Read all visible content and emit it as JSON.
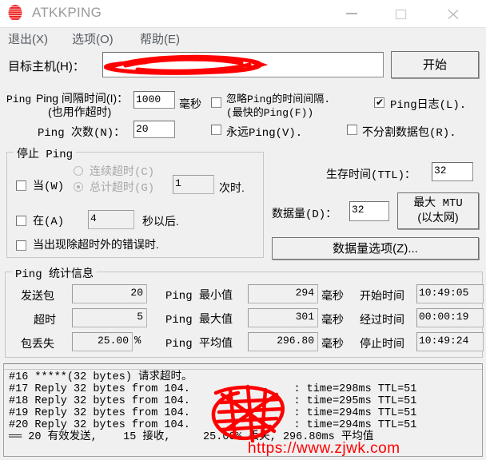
{
  "window": {
    "title": "ATKKPING",
    "icon": "striped-globe-icon",
    "controls": {
      "minimize": "minimize-icon",
      "maximize": "maximize-icon",
      "close": "close-icon"
    }
  },
  "menu": {
    "items": [
      {
        "label": "退出(X)"
      },
      {
        "label": "选项(O)"
      },
      {
        "label": "帮助(E)"
      }
    ]
  },
  "target": {
    "label": "目标主机(H)：",
    "value": "",
    "redacted": true,
    "start_button": "开始"
  },
  "ping_options": {
    "interval_label_line1": "Ping 间隔时间(I)：",
    "interval_label_line2": "(也用作超时)",
    "interval_value": "1000",
    "interval_unit": "毫秒",
    "ignore_interval_label_line1": "忽略Ping的时间间隔.",
    "ignore_interval_label_line2": "(最快的Ping(F))",
    "ignore_interval_checked": false,
    "ping_log_label": "Ping日志(L).",
    "ping_log_checked": true,
    "count_label": "Ping 次数(N)：",
    "count_value": "20",
    "forever_label": "永远Ping(V).",
    "forever_checked": false,
    "nofrag_label": "不分割数据包(R).",
    "nofrag_checked": false
  },
  "stop_ping": {
    "group_title": "停止 Ping",
    "when_label": "当(W)",
    "when_checked": false,
    "radio_consecutive": "连续超时(C)",
    "radio_consecutive_selected": false,
    "radio_total": "总计超时(G)",
    "radio_total_selected": true,
    "times_value": "1",
    "times_suffix": "次时.",
    "after_label": "在(A)",
    "after_checked": false,
    "after_value": "4",
    "after_suffix": "秒以后.",
    "on_error_label": "当出现除超时外的错误时.",
    "on_error_checked": false
  },
  "packet": {
    "ttl_label": "生存时间(TTL)：",
    "ttl_value": "32",
    "size_label": "数据量(D)：",
    "size_value": "32",
    "mtu_button_line1": "最大 MTU",
    "mtu_button_line2": "(以太网)",
    "data_options_button": "数据量选项(Z)..."
  },
  "stats": {
    "group_title": "Ping 统计信息",
    "rows": [
      {
        "label_a": "发送包",
        "value_a": "20",
        "unit_a": "",
        "label_b": "Ping 最小值",
        "value_b": "294",
        "unit_b": "毫秒",
        "label_c": "开始时间",
        "value_c": "10:49:05"
      },
      {
        "label_a": "超时",
        "value_a": "5",
        "unit_a": "",
        "label_b": "Ping 最大值",
        "value_b": "301",
        "unit_b": "毫秒",
        "label_c": "经过时间",
        "value_c": "00:00:19"
      },
      {
        "label_a": "包丢失",
        "value_a": "25.00",
        "unit_a": "%",
        "label_b": "Ping 平均值",
        "value_b": "296.80",
        "unit_b": "毫秒",
        "label_c": "停止时间",
        "value_c": "10:49:24"
      }
    ]
  },
  "log": {
    "lines": [
      "#16 *****(32 bytes) 请求超时。",
      "#17 Reply 32 bytes from 104.                : time=298ms TTL=51",
      "#18 Reply 32 bytes from 104.                : time=295ms TTL=51",
      "#19 Reply 32 bytes from 104.                : time=294ms TTL=51",
      "#20 Reply 32 bytes from 104.                : time=294ms TTL=51",
      "══ 20 有效发送,    15 接收,     25.00% 丢失, 296.80ms 平均值"
    ]
  },
  "watermark": {
    "text": "https://www.zjwk.com",
    "color": "#ff0000"
  },
  "theme": {
    "window_bg": "#f0f0f0",
    "titlebar_bg": "#ffffff",
    "title_color": "#9a9a9a",
    "menu_color": "#555a60",
    "accent_red": "#ee2222"
  }
}
